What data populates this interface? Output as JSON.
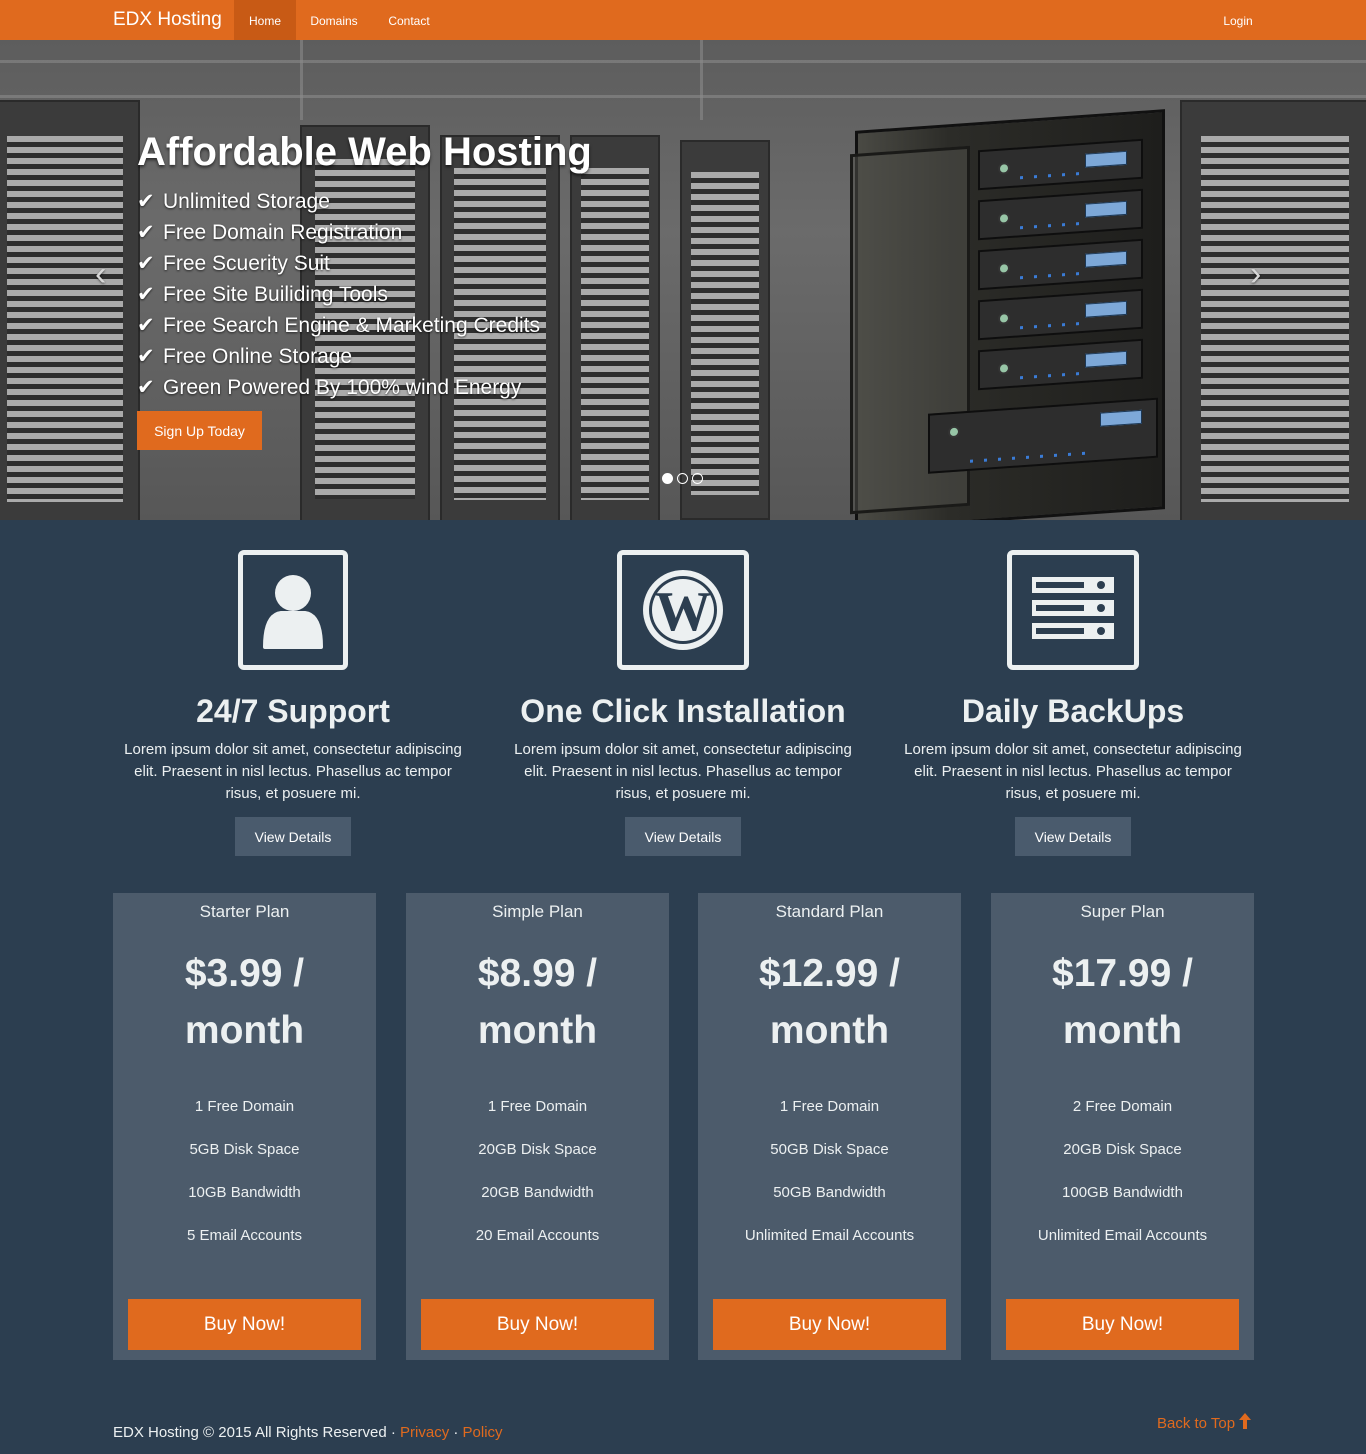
{
  "navbar": {
    "brand": "EDX Hosting",
    "links": [
      "Home",
      "Domains",
      "Contact"
    ],
    "login": "Login"
  },
  "hero": {
    "title": "Affordable Web Hosting",
    "features": [
      "Unlimited Storage",
      "Free Domain Registration",
      "Free Scuerity Suit",
      "Free Site Builiding Tools",
      "Free Search Engine & Marketing Credits",
      "Free Online Storage",
      "Green Powered By 100% wind Energy"
    ],
    "cta": "Sign Up Today",
    "check_glyph": "✔",
    "prev_glyph": "‹",
    "next_glyph": "›",
    "slide_count": 3,
    "active_slide": 1
  },
  "features": [
    {
      "icon": "user-icon",
      "title": "24/7 Support",
      "text": "Lorem ipsum dolor sit amet, consectetur adipiscing elit. Praesent in nisl lectus. Phasellus ac tempor risus, et posuere mi.",
      "button": "View Details"
    },
    {
      "icon": "wordpress-icon",
      "title": "One Click Installation",
      "text": "Lorem ipsum dolor sit amet, consectetur adipiscing elit. Praesent in nisl lectus. Phasellus ac tempor risus, et posuere mi.",
      "button": "View Details"
    },
    {
      "icon": "server-icon",
      "title": "Daily BackUps",
      "text": "Lorem ipsum dolor sit amet, consectetur adipiscing elit. Praesent in nisl lectus. Phasellus ac tempor risus, et posuere mi.",
      "button": "View Details"
    }
  ],
  "plans": [
    {
      "name": "Starter Plan",
      "price": "$3.99 / month",
      "features": [
        "1 Free Domain",
        "5GB Disk Space",
        "10GB Bandwidth",
        "5 Email Accounts"
      ],
      "button": "Buy Now!"
    },
    {
      "name": "Simple Plan",
      "price": "$8.99 / month",
      "features": [
        "1 Free Domain",
        "20GB Disk Space",
        "20GB Bandwidth",
        "20 Email Accounts"
      ],
      "button": "Buy Now!"
    },
    {
      "name": "Standard Plan",
      "price": "$12.99 / month",
      "features": [
        "1 Free Domain",
        "50GB Disk Space",
        "50GB Bandwidth",
        "Unlimited Email Accounts"
      ],
      "button": "Buy Now!"
    },
    {
      "name": "Super Plan",
      "price": "$17.99 / month",
      "features": [
        "2 Free Domain",
        "20GB Disk Space",
        "100GB Bandwidth",
        "Unlimited Email Accounts"
      ],
      "button": "Buy Now!"
    }
  ],
  "footer": {
    "copyright": "EDX Hosting © 2015 All Rights Reserved · ",
    "privacy": "Privacy",
    "separator": " · ",
    "policy": "Policy",
    "back_to_top": "Back to Top"
  },
  "colors": {
    "accent": "#e06a1e",
    "background": "#2c3e50",
    "plan_card": "#4c5b6b",
    "secondary_button": "#4a5b6d"
  }
}
